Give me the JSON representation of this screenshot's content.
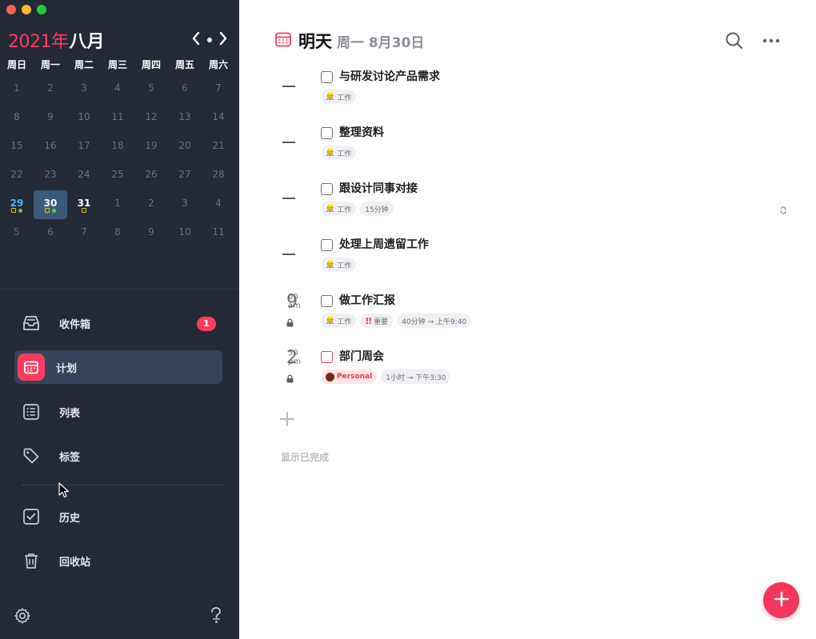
{
  "calendar": {
    "year": "2021年",
    "month": "八月",
    "weekdays": [
      "周日",
      "周一",
      "周二",
      "周三",
      "周四",
      "周五",
      "周六"
    ],
    "weeks": [
      [
        "1",
        "2",
        "3",
        "4",
        "5",
        "6",
        "7"
      ],
      [
        "8",
        "9",
        "10",
        "11",
        "12",
        "13",
        "14"
      ],
      [
        "15",
        "16",
        "17",
        "18",
        "19",
        "20",
        "21"
      ],
      [
        "22",
        "23",
        "24",
        "25",
        "26",
        "27",
        "28"
      ],
      [
        "29",
        "30",
        "31",
        "1",
        "2",
        "3",
        "4"
      ],
      [
        "5",
        "6",
        "7",
        "8",
        "9",
        "10",
        "11"
      ]
    ]
  },
  "sidebar": {
    "items": [
      {
        "label": "收件箱",
        "badge": "1"
      },
      {
        "label": "计划"
      },
      {
        "label": "列表"
      },
      {
        "label": "标签"
      },
      {
        "label": "历史"
      },
      {
        "label": "回收站"
      }
    ]
  },
  "main": {
    "title": "明天",
    "subtitle": "周一 8月30日",
    "tasks": [
      {
        "title": "与研发讨论产品需求",
        "tags": [
          "工作"
        ]
      },
      {
        "title": "整理资料",
        "tags": [
          "工作"
        ]
      },
      {
        "title": "跟设计同事对接",
        "tags": [
          "工作",
          "15分钟"
        ]
      },
      {
        "title": "处理上周遗留工作",
        "tags": [
          "工作"
        ]
      },
      {
        "time_hour": "9",
        "time_min": "00",
        "time_ampm": "am",
        "title": "做工作汇报",
        "tags": [
          "工作",
          "重要",
          "40分钟 → 上午9:40"
        ]
      },
      {
        "time_hour": "2",
        "time_min": "30",
        "time_ampm": "pm",
        "title": "部门周会",
        "tags": [
          "Personal",
          "1小时 → 下午3:30"
        ]
      }
    ],
    "show_completed": "显示已完成"
  },
  "colors": {
    "accent": "#ff3b5f",
    "sidebar_bg": "#232a36",
    "selected_day_bg": "#3b5a7a",
    "today_blue": "#4fb3ff"
  },
  "icons": {
    "title": "calendar-icon",
    "search": "search-icon",
    "more": "more-icon",
    "inbox": "inbox-icon",
    "plan": "calendar-icon",
    "list": "list-icon",
    "tag": "tag-icon",
    "history": "checkbox-icon",
    "trash": "trash-icon",
    "settings": "gear-icon",
    "help": "help-icon",
    "add": "plus-icon"
  }
}
